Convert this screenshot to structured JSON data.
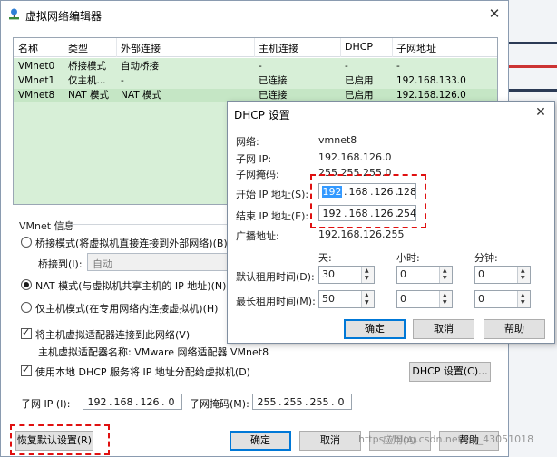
{
  "window": {
    "title": "虚拟网络编辑器",
    "close_glyph": "✕"
  },
  "table": {
    "headers": [
      "名称",
      "类型",
      "外部连接",
      "主机连接",
      "DHCP",
      "子网地址"
    ],
    "rows": [
      {
        "name": "VMnet0",
        "type": "桥接模式",
        "external": "自动桥接",
        "host": "-",
        "dhcp": "-",
        "subnet": "-"
      },
      {
        "name": "VMnet1",
        "type": "仅主机...",
        "external": "-",
        "host": "已连接",
        "dhcp": "已启用",
        "subnet": "192.168.133.0"
      },
      {
        "name": "VMnet8",
        "type": "NAT 模式",
        "external": "NAT 模式",
        "host": "已连接",
        "dhcp": "已启用",
        "subnet": "192.168.126.0"
      }
    ],
    "selected_row": 2
  },
  "vmnet_info": {
    "group_label": "VMnet 信息",
    "bridge_label": "桥接模式(将虚拟机直接连接到外部网络)(B)",
    "bridged_to_label": "桥接到(I):",
    "bridged_to_value": "自动",
    "nat_label": "NAT 模式(与虚拟机共享主机的 IP 地址)(N)",
    "hostonly_label": "仅主机模式(在专用网络内连接虚拟机)(H)",
    "selected_mode": "nat",
    "connect_adapter_label": "将主机虚拟适配器连接到此网络(V)",
    "adapter_name_label": "主机虚拟适配器名称: VMware 网络适配器 VMnet8",
    "use_dhcp_label": "使用本地 DHCP 服务将 IP 地址分配给虚拟机(D)",
    "dhcp_settings_button": "DHCP 设置(C)...",
    "subnet_ip_label": "子网 IP (I):",
    "subnet_ip": [
      "192",
      "168",
      "126",
      "0"
    ],
    "subnet_mask_label": "子网掩码(M):",
    "subnet_mask": [
      "255",
      "255",
      "255",
      "0"
    ]
  },
  "footer": {
    "restore_defaults": "恢复默认设置(R)",
    "ok": "确定",
    "cancel": "取消",
    "apply": "应用(A)",
    "help": "帮助"
  },
  "dhcp_dialog": {
    "title": "DHCP 设置",
    "close_glyph": "✕",
    "network_label": "网络:",
    "network_value": "vmnet8",
    "subnet_ip_label": "子网 IP:",
    "subnet_ip_value": "192.168.126.0",
    "subnet_mask_label": "子网掩码:",
    "subnet_mask_value": "255.255.255.0",
    "start_ip_label": "开始 IP 地址(S):",
    "start_ip": [
      "192",
      "168",
      "126",
      "128"
    ],
    "end_ip_label": "结束 IP 地址(E):",
    "end_ip": [
      "192",
      "168",
      "126",
      "254"
    ],
    "broadcast_label": "广播地址:",
    "broadcast_value": "192.168.126.255",
    "days_label": "天:",
    "hours_label": "小时:",
    "minutes_label": "分钟:",
    "default_lease_label": "默认租用时间(D):",
    "default_lease": [
      "30",
      "0",
      "0"
    ],
    "max_lease_label": "最长租用时间(M):",
    "max_lease": [
      "50",
      "0",
      "0"
    ],
    "ok": "确定",
    "cancel": "取消",
    "help": "帮助"
  },
  "watermark": "https://blog.csdn.net/qq_43051018",
  "colors": {
    "highlight_red": "#e01010",
    "table_green": "#d7efd7",
    "accent_blue": "#0078d7"
  }
}
